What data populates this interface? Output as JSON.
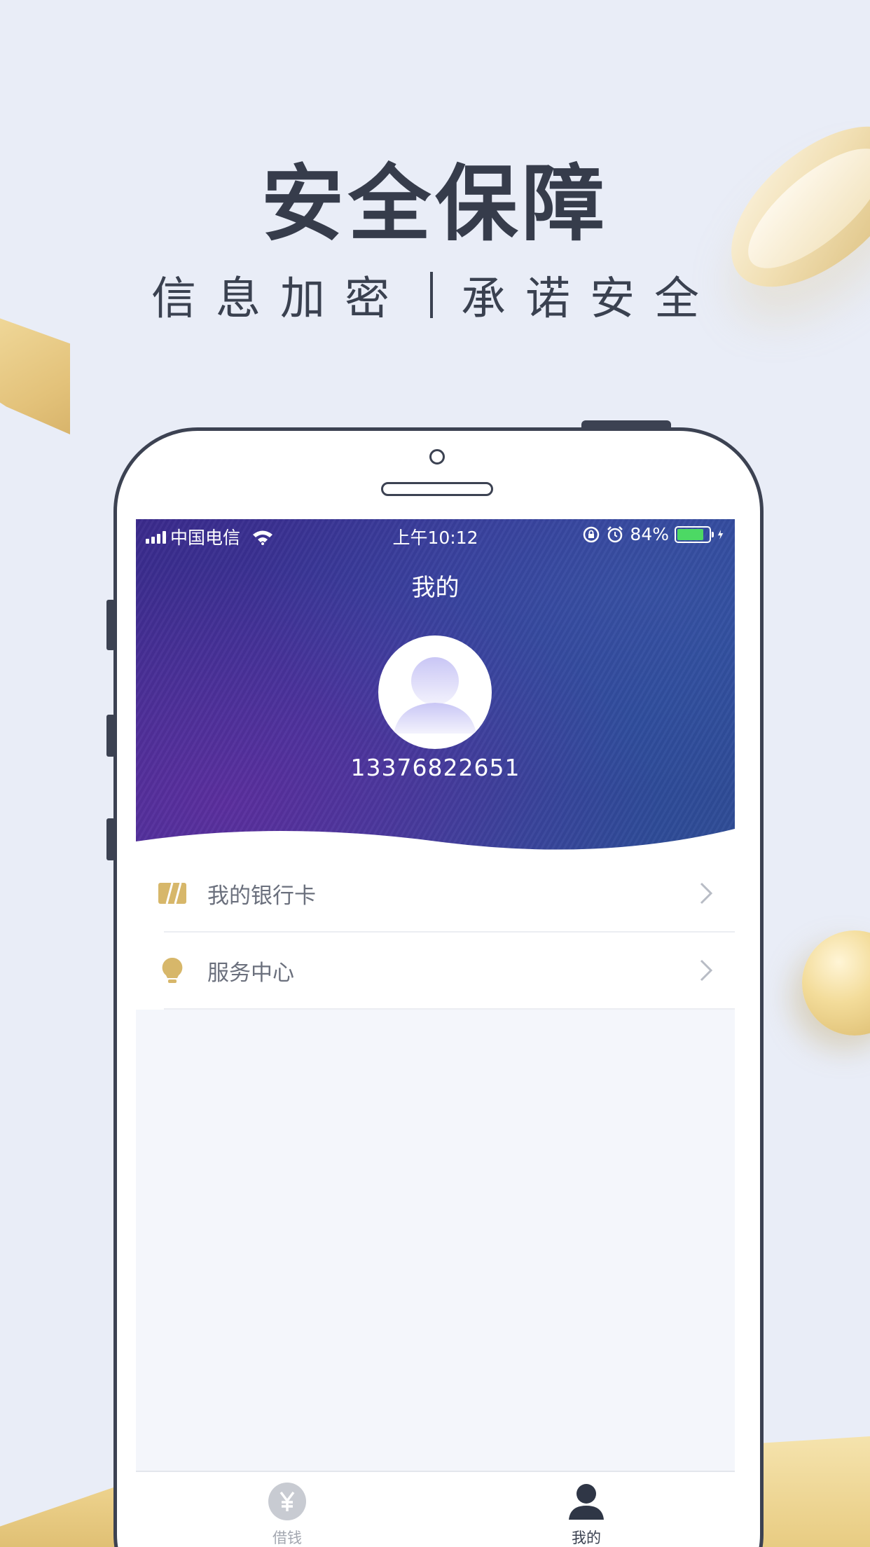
{
  "headline": {
    "title": "安全保障",
    "sub_left": "信息加密",
    "sub_right": "承诺安全"
  },
  "status_bar": {
    "carrier": "中国电信",
    "time": "上午10:12",
    "battery_text": "84%",
    "battery_level": 0.84
  },
  "page": {
    "title": "我的",
    "phone_number": "13376822651"
  },
  "menu": {
    "items": [
      {
        "label": "我的银行卡",
        "icon": "bank-card-icon"
      },
      {
        "label": "服务中心",
        "icon": "lightbulb-icon"
      }
    ]
  },
  "tabbar": {
    "tabs": [
      {
        "label": "借钱",
        "icon": "yen-coin-icon",
        "active": false
      },
      {
        "label": "我的",
        "icon": "user-icon",
        "active": true
      }
    ]
  },
  "colors": {
    "background": "#e9edf7",
    "accent_gold": "#d7b76a",
    "text_dark": "#3a4150",
    "hero_purple": "#3b2a8c",
    "battery_green": "#4cd964"
  }
}
